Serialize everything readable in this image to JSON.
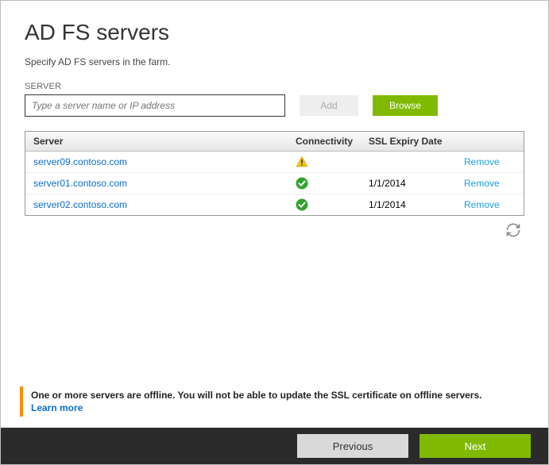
{
  "header": {
    "title": "AD FS servers",
    "description": "Specify AD FS servers in the farm."
  },
  "input": {
    "label": "SERVER",
    "placeholder": "Type a server name or IP address",
    "value": ""
  },
  "buttons": {
    "add": "Add",
    "browse": "Browse",
    "previous": "Previous",
    "next": "Next"
  },
  "table": {
    "columns": {
      "server": "Server",
      "connectivity": "Connectivity",
      "ssl": "SSL Expiry Date",
      "action": ""
    },
    "rows": [
      {
        "server": "server09.contoso.com",
        "status": "warning",
        "ssl": "",
        "action": "Remove"
      },
      {
        "server": "server01.contoso.com",
        "status": "ok",
        "ssl": "1/1/2014",
        "action": "Remove"
      },
      {
        "server": "server02.contoso.com",
        "status": "ok",
        "ssl": "1/1/2014",
        "action": "Remove"
      }
    ]
  },
  "alert": {
    "text": "One or more servers are offline. You will not be able to update the SSL certificate on offline servers.",
    "learn_more": "Learn more"
  },
  "icons": {
    "refresh": "refresh-icon"
  }
}
